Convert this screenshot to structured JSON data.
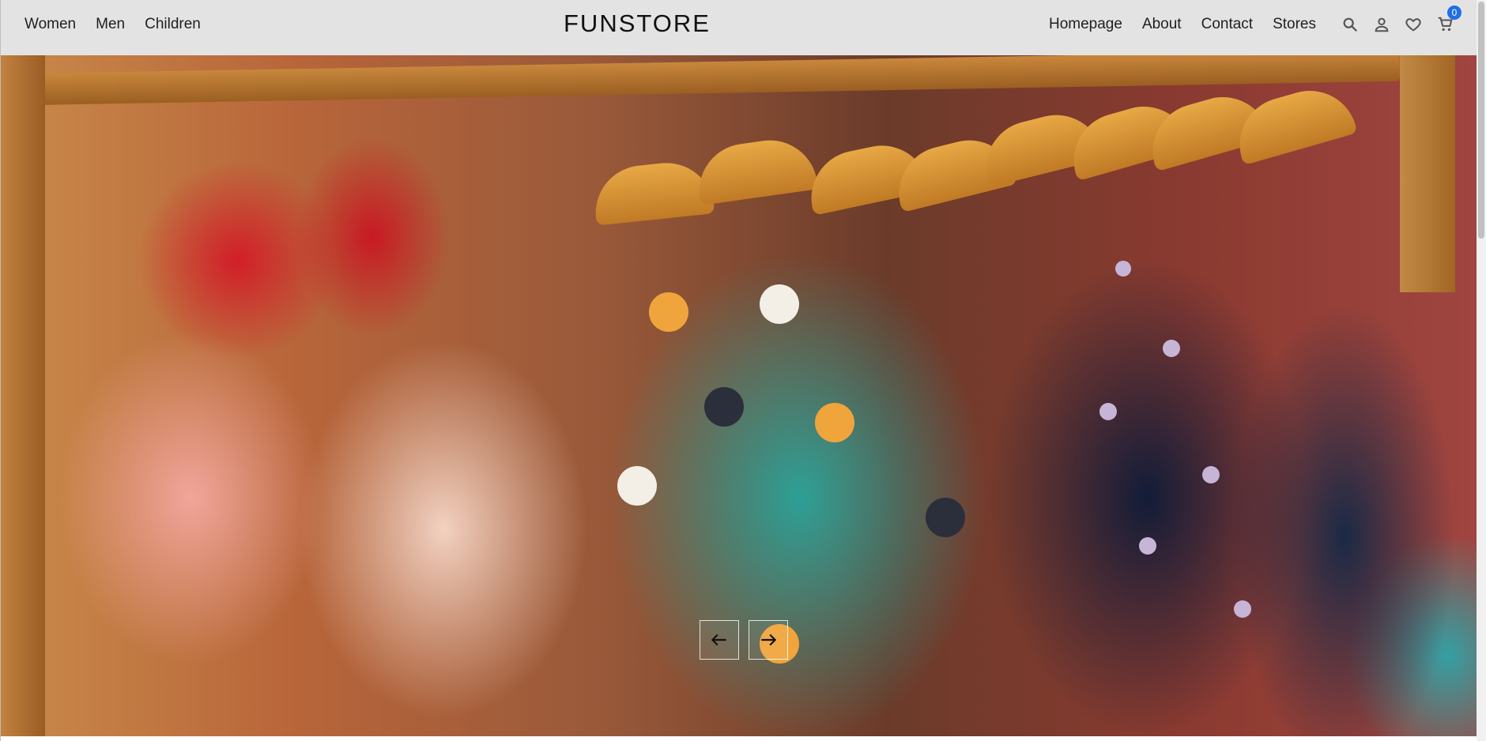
{
  "header": {
    "brand": "FUNSTORE",
    "left_nav": [
      "Women",
      "Men",
      "Children"
    ],
    "right_nav": [
      "Homepage",
      "About",
      "Contact",
      "Stores"
    ],
    "cart_count": "0"
  },
  "icons": [
    "search-icon",
    "user-icon",
    "heart-icon",
    "cart-icon"
  ],
  "hero": {
    "controls": [
      "arrow-left-icon",
      "arrow-right-icon"
    ]
  },
  "colors": {
    "navbar_bg": "#e3e3e3",
    "badge": "#1f6fe5"
  }
}
